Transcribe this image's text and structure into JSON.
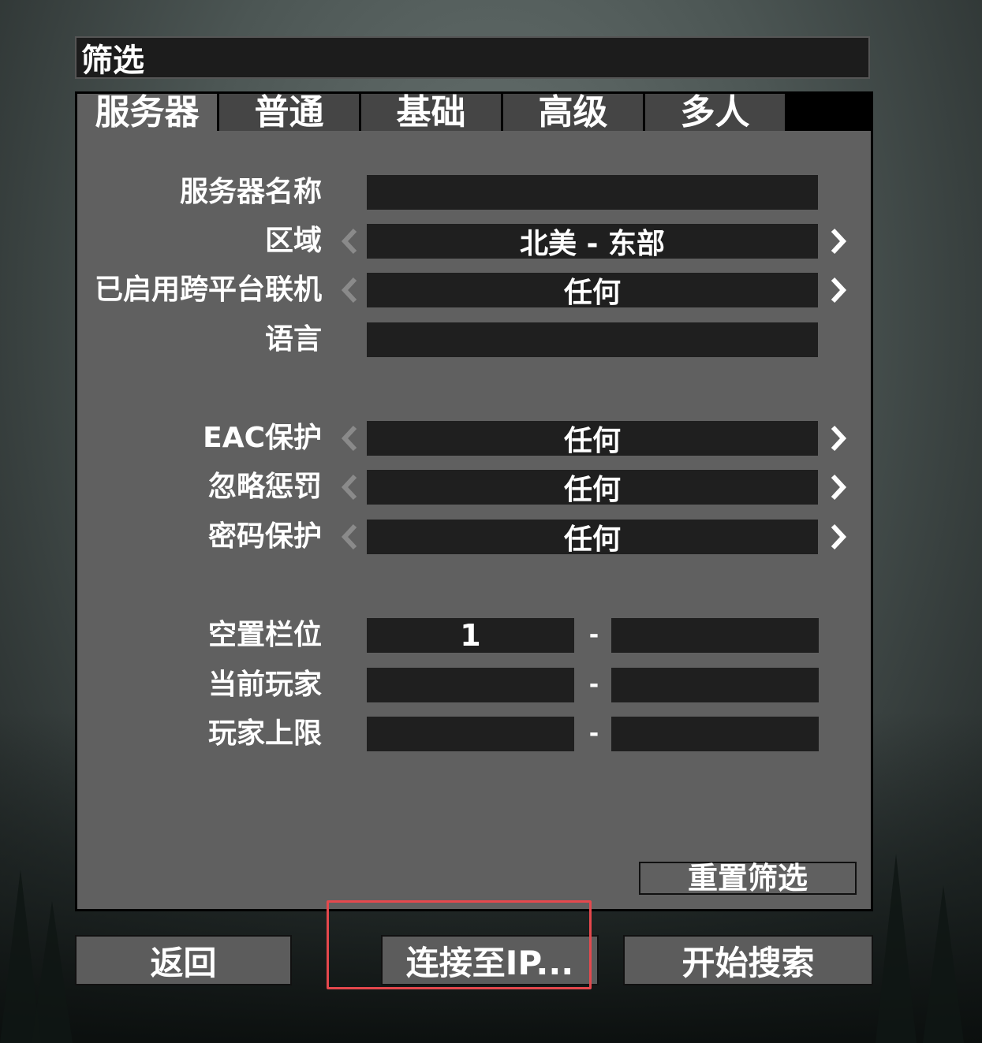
{
  "title": "筛选",
  "tabs": [
    {
      "label": "服务器",
      "active": true
    },
    {
      "label": "普通",
      "active": false
    },
    {
      "label": "基础",
      "active": false
    },
    {
      "label": "高级",
      "active": false
    },
    {
      "label": "多人",
      "active": false
    }
  ],
  "fields": {
    "server_name": {
      "label": "服务器名称",
      "value": ""
    },
    "region": {
      "label": "区域",
      "value": "北美 - 东部"
    },
    "crossplay": {
      "label": "已启用跨平台联机",
      "value": "任何"
    },
    "language": {
      "label": "语言",
      "value": ""
    },
    "eac": {
      "label": "EAC保护",
      "value": "任何"
    },
    "ignore_penalty": {
      "label": "忽略惩罚",
      "value": "任何"
    },
    "password": {
      "label": "密码保护",
      "value": "任何"
    },
    "free_slots": {
      "label": "空置栏位",
      "min": "1",
      "max": ""
    },
    "current_players": {
      "label": "当前玩家",
      "min": "",
      "max": ""
    },
    "max_players": {
      "label": "玩家上限",
      "min": "",
      "max": ""
    }
  },
  "range_separator": "-",
  "buttons": {
    "reset": "重置筛选",
    "back": "返回",
    "connect_ip": "连接至IP...",
    "start_search": "开始搜索"
  },
  "colors": {
    "highlight": "#e5484d",
    "panel": "#606060",
    "field": "#1f1f1f"
  },
  "icons": {
    "prev": "chevron-left-icon",
    "next": "chevron-right-icon"
  }
}
